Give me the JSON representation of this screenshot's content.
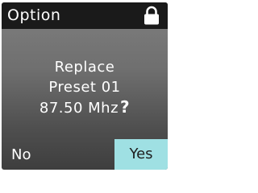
{
  "header": {
    "title": "Option",
    "icon": "lock-icon"
  },
  "dialog": {
    "line1": "Replace",
    "line2": "Preset 01",
    "line3": "87.50 Mhz",
    "question_mark": "?"
  },
  "buttons": {
    "no_label": "No",
    "yes_label": "Yes"
  },
  "colors": {
    "titlebar": "#1a1a1a",
    "background_top": "#7f7f7f",
    "background_bottom": "#3e3e3e",
    "yes_highlight": "#9fe0e3",
    "text": "#ffffff"
  }
}
